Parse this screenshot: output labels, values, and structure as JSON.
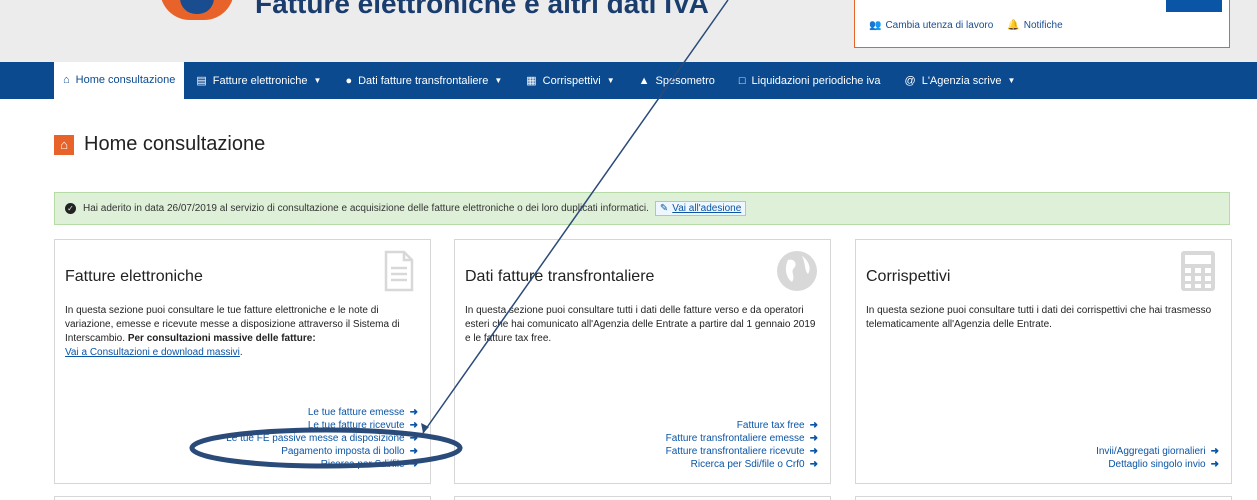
{
  "header": {
    "site_title": "Fatture elettroniche e altri dati IVA",
    "user_links": [
      {
        "icon": "users-icon",
        "label": "Cambia utenza di lavoro"
      },
      {
        "icon": "bell-icon",
        "label": "Notifiche"
      }
    ]
  },
  "nav": {
    "items": [
      {
        "icon": "home-icon",
        "label": "Home consultazione",
        "active": true,
        "caret": false
      },
      {
        "icon": "document-icon",
        "label": "Fatture elettroniche",
        "active": false,
        "caret": true
      },
      {
        "icon": "globe-icon",
        "label": "Dati fatture transfrontaliere",
        "active": false,
        "caret": true
      },
      {
        "icon": "calculator-icon",
        "label": "Corrispettivi",
        "active": false,
        "caret": true
      },
      {
        "icon": "bag-icon",
        "label": "Spesometro",
        "active": false,
        "caret": false
      },
      {
        "icon": "file-icon",
        "label": "Liquidazioni periodiche iva",
        "active": false,
        "caret": false
      },
      {
        "icon": "at-icon",
        "label": "L'Agenzia scrive",
        "active": false,
        "caret": true
      }
    ]
  },
  "page": {
    "title": "Home consultazione"
  },
  "alert": {
    "text": "Hai aderito in data 26/07/2019 al servizio di consultazione e acquisizione delle fatture elettroniche o dei loro duplicati informatici.",
    "link_label": "Vai all'adesione"
  },
  "cards": [
    {
      "title": "Fatture elettroniche",
      "icon": "document-icon",
      "desc": "In questa sezione puoi consultare le tue fatture elettroniche e le note di variazione, emesse e ricevute messe a disposizione attraverso il Sistema di Interscambio.",
      "desc_bold": "Per consultazioni massive delle fatture:",
      "desc_link": "Vai a Consultazioni e download massivi",
      "links": [
        "Le tue fatture emesse",
        "Le tue fatture ricevute",
        "Le tue FE passive messe a disposizione",
        "Pagamento imposta di bollo",
        "Ricerca per Sdi/file"
      ]
    },
    {
      "title": "Dati fatture transfrontaliere",
      "icon": "globe-icon",
      "desc": "In questa sezione puoi consultare tutti i dati delle fatture verso e da operatori esteri che hai comunicato all'Agenzia delle Entrate a partire dal 1 gennaio 2019 e le fatture tax free.",
      "links": [
        "Fatture tax free",
        "Fatture transfrontaliere emesse",
        "Fatture transfrontaliere ricevute",
        "Ricerca per Sdi/file o Crf0"
      ]
    },
    {
      "title": "Corrispettivi",
      "icon": "calculator-icon",
      "desc": "In questa sezione puoi consultare tutti i dati dei corrispettivi che hai trasmesso telematicamente all'Agenzia delle Entrate.",
      "links": [
        "Invii/Aggregati giornalieri",
        "Dettaglio singolo invio"
      ]
    }
  ],
  "colors": {
    "nav_bg": "#0b4a8f",
    "accent": "#e8632a",
    "link": "#0b55a6",
    "alert_bg": "#dff0d8",
    "annotation": "#2a4a7a"
  }
}
